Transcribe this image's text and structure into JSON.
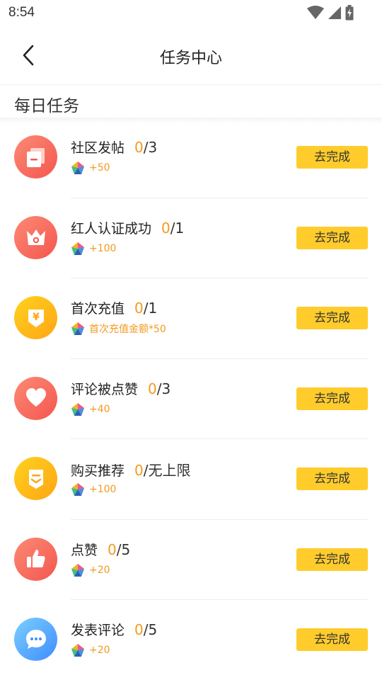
{
  "status_bar": {
    "time": "8:54",
    "icons": [
      "wifi-icon",
      "cellular-signal-icon",
      "battery-charging-icon"
    ]
  },
  "header": {
    "title": "任务中心",
    "back_icon": "chevron-left-icon"
  },
  "section": {
    "title": "每日任务"
  },
  "colors": {
    "accent_orange": "#f39a1f",
    "button_yellow": "#ffcc2b",
    "icon_red_start": "#fb7a6a",
    "icon_red_end": "#f5564f",
    "icon_yellow_start": "#ffcc1a",
    "icon_yellow_end": "#ffa514",
    "icon_blue_start": "#6ec8ff",
    "icon_blue_end": "#3f8cff"
  },
  "tasks": [
    {
      "name": "社区发帖",
      "done": "0",
      "total": "/3",
      "reward": "+50",
      "button": "去完成",
      "icon": "post-icon",
      "icon_color": "red"
    },
    {
      "name": "红人认证成功",
      "done": "0",
      "total": "/1",
      "reward": "+100",
      "button": "去完成",
      "icon": "crown-icon",
      "icon_color": "red"
    },
    {
      "name": "首次充值",
      "done": "0",
      "total": "/1",
      "reward": "首次充值金额*50",
      "button": "去完成",
      "icon": "yen-icon",
      "icon_color": "yellow"
    },
    {
      "name": "评论被点赞",
      "done": "0",
      "total": "/3",
      "reward": "+40",
      "button": "去完成",
      "icon": "heart-icon",
      "icon_color": "red"
    },
    {
      "name": "购买推荐",
      "done": "0",
      "total": "/无上限",
      "reward": "+100",
      "button": "去完成",
      "icon": "receipt-icon",
      "icon_color": "yellow"
    },
    {
      "name": "点赞",
      "done": "0",
      "total": "/5",
      "reward": "+20",
      "button": "去完成",
      "icon": "thumbs-up-icon",
      "icon_color": "red"
    },
    {
      "name": "发表评论",
      "done": "0",
      "total": "/5",
      "reward": "+20",
      "button": "去完成",
      "icon": "chat-bubble-icon",
      "icon_color": "blue"
    }
  ]
}
